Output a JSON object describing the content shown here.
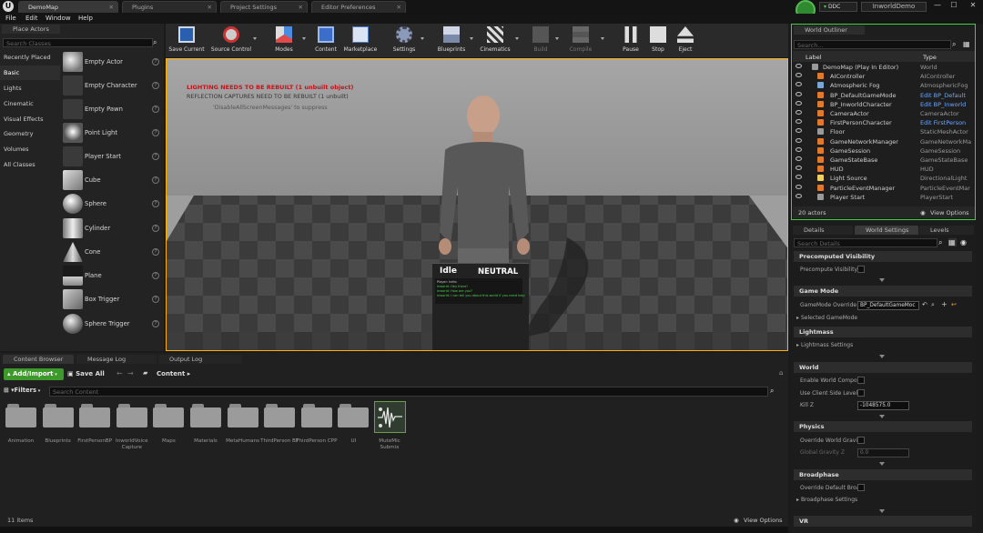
{
  "app": {
    "tabs": [
      "DemoMap",
      "Plugins",
      "Project Settings",
      "Editor Preferences"
    ],
    "ddc_label": "DDC",
    "project_name": "InworldDemo"
  },
  "menu": [
    "File",
    "Edit",
    "Window",
    "Help"
  ],
  "place_actors": {
    "tab_label": "Place Actors",
    "search_placeholder": "Search Classes",
    "categories": [
      "Recently Placed",
      "Basic",
      "Lights",
      "Cinematic",
      "Visual Effects",
      "Geometry",
      "Volumes",
      "All Classes"
    ],
    "active_category": "Basic",
    "items": [
      "Empty Actor",
      "Empty Character",
      "Empty Pawn",
      "Point Light",
      "Player Start",
      "Cube",
      "Sphere",
      "Cylinder",
      "Cone",
      "Plane",
      "Box Trigger",
      "Sphere Trigger"
    ]
  },
  "toolbar": {
    "buttons": [
      "Save Current",
      "Source Control",
      "Modes",
      "Content",
      "Marketplace",
      "Settings",
      "Blueprints",
      "Cinematics",
      "Build",
      "Compile",
      "Pause",
      "Stop",
      "Eject"
    ]
  },
  "viewport": {
    "warning1": "LIGHTING NEEDS TO BE REBUILT (1 unbuilt object)",
    "warning2": "REFLECTION CAPTURES NEED TO BE REBUILT (1 unbuilt)",
    "warning3": "'DisableAllScreenMessages' to suppress",
    "npc_state": "Idle",
    "npc_emotion": "NEUTRAL",
    "chat_lines": [
      "Player: hello",
      "Inworld: Hey there!",
      "Inworld: How are you?",
      "Inworld: I can tell you about this world if you need help"
    ]
  },
  "world_outliner": {
    "tab_label": "World Outliner",
    "search_placeholder": "Search...",
    "col_label": "Label",
    "col_type": "Type",
    "rows": [
      {
        "label": "DemoMap (Play In Editor)",
        "type": "World",
        "icon": "world-icon",
        "color": "#9a9a9a"
      },
      {
        "label": "AIController",
        "type": "AIController",
        "icon": "controller-icon",
        "color": "#e07a2a"
      },
      {
        "label": "Atmospheric Fog",
        "type": "AtmosphericFog",
        "icon": "fog-icon",
        "color": "#7aa6d6"
      },
      {
        "label": "BP_DefaultGameMode",
        "type": "Edit BP_Default",
        "icon": "blueprint-icon",
        "color": "#e07a2a"
      },
      {
        "label": "BP_InworldCharacter",
        "type": "Edit BP_Inworld",
        "icon": "blueprint-icon",
        "color": "#e07a2a"
      },
      {
        "label": "CameraActor",
        "type": "CameraActor",
        "icon": "camera-icon",
        "color": "#e07a2a"
      },
      {
        "label": "FirstPersonCharacter",
        "type": "Edit FirstPerson",
        "icon": "character-icon",
        "color": "#e07a2a"
      },
      {
        "label": "Floor",
        "type": "StaticMeshActor",
        "icon": "mesh-icon",
        "color": "#9a9a9a"
      },
      {
        "label": "GameNetworkManager",
        "type": "GameNetworkMa",
        "icon": "network-icon",
        "color": "#e07a2a"
      },
      {
        "label": "GameSession",
        "type": "GameSession",
        "icon": "session-icon",
        "color": "#e07a2a"
      },
      {
        "label": "GameStateBase",
        "type": "GameStateBase",
        "icon": "state-icon",
        "color": "#e07a2a"
      },
      {
        "label": "HUD",
        "type": "HUD",
        "icon": "hud-icon",
        "color": "#e07a2a"
      },
      {
        "label": "Light Source",
        "type": "DirectionalLight",
        "icon": "light-icon",
        "color": "#f0d060"
      },
      {
        "label": "ParticleEventManager",
        "type": "ParticleEventMar",
        "icon": "particle-icon",
        "color": "#e07a2a"
      },
      {
        "label": "Player Start",
        "type": "PlayerStart",
        "icon": "player-start-icon",
        "color": "#9a9a9a"
      }
    ],
    "actor_count": "20 actors",
    "view_options": "View Options"
  },
  "details": {
    "tabs": [
      "Details",
      "World Settings",
      "Levels"
    ],
    "search_placeholder": "Search Details",
    "sections": {
      "precomputed": "Precomputed Visibility",
      "precompute_label": "Precompute Visibility",
      "game_mode": "Game Mode",
      "game_mode_override_label": "GameMode Override",
      "game_mode_override_value": "BP_DefaultGameMoc",
      "selected_game_mode": "Selected GameMode",
      "lightmass": "Lightmass",
      "lightmass_settings": "Lightmass Settings",
      "world": "World",
      "enable_world_compos": "Enable World Compos",
      "use_client_side_level": "Use Client Side Level",
      "kill_z_label": "Kill Z",
      "kill_z_value": "-1048575.0",
      "physics": "Physics",
      "override_world_gravity": "Override World Gravit",
      "global_gravity_label": "Global Gravity Z",
      "global_gravity_value": "0.0",
      "broadphase": "Broadphase",
      "override_default_broadphase": "Override Default Broa",
      "broadphase_settings": "Broadphase Settings",
      "vr": "VR"
    }
  },
  "bottom_tabs": [
    "Content Browser",
    "Message Log",
    "Output Log"
  ],
  "content_browser": {
    "add_import": "Add/Import",
    "save_all": "Save All",
    "path": "Content",
    "filters": "Filters",
    "search_placeholder": "Search Content",
    "folders": [
      "Animation",
      "Blueprints",
      "FirstPersonBP",
      "InworldVoice Capture",
      "Maps",
      "Materials",
      "MetaHumans",
      "ThirdPerson BP",
      "ThirdPerson CPP",
      "UI"
    ],
    "asset": "MuteMic Submix",
    "item_count": "11 items",
    "view_options": "View Options"
  }
}
